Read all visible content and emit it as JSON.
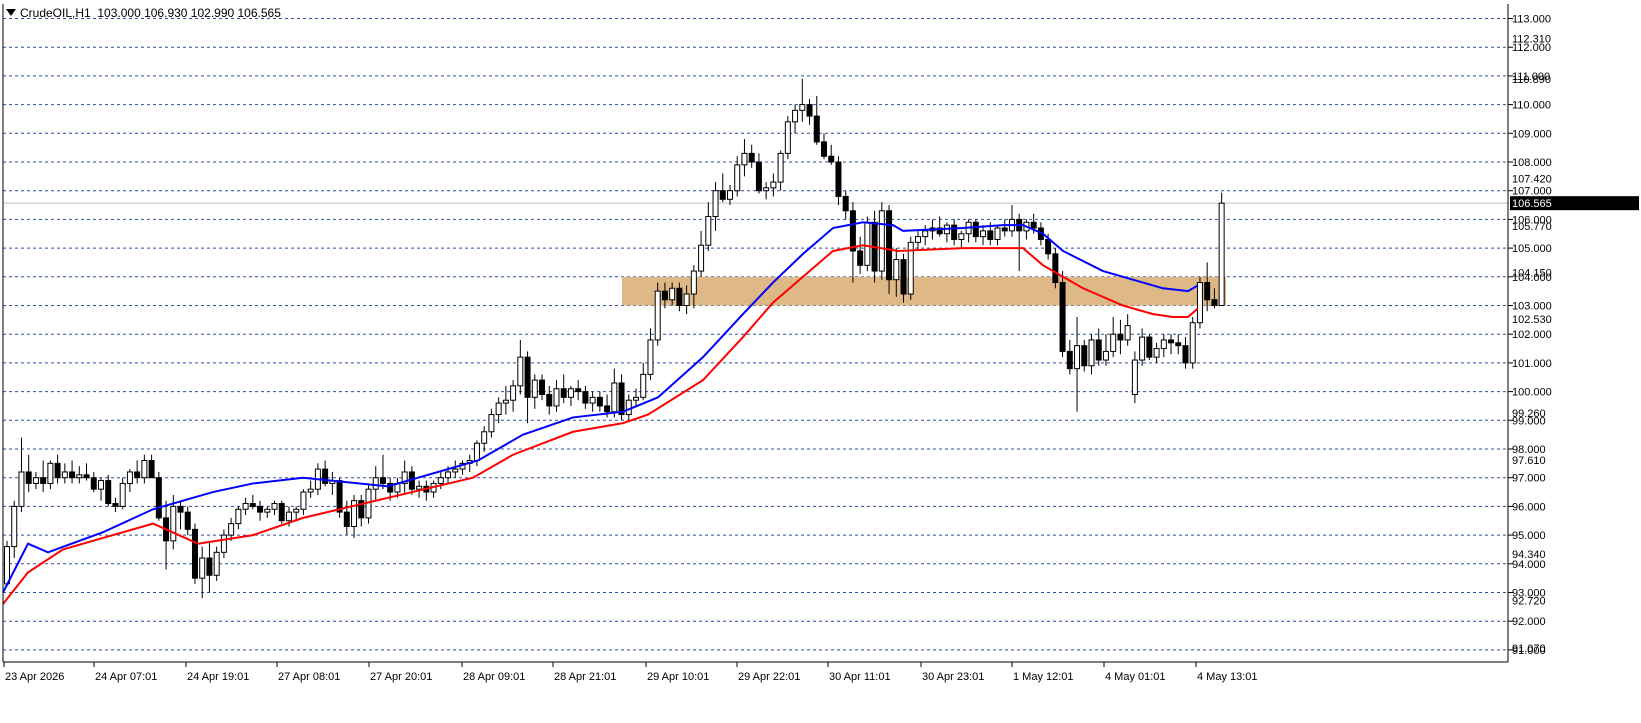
{
  "header": {
    "symbol_timeframe": "CrudeOIL,H1",
    "ohlc": "103.000 106.930 102.990 106.565"
  },
  "colors": {
    "bullish_body": "#ffffff",
    "bearish_body": "#000000",
    "ma_fast": "#0000ff",
    "ma_slow": "#ff0000",
    "zone_fill": "#deb887",
    "grid": "#2f4f9f",
    "price_line": "#c0c0c0"
  },
  "chart_data": {
    "type": "candlestick",
    "symbol": "CrudeOIL",
    "timeframe": "H1",
    "grid": true,
    "last_price": 106.565,
    "ylim": [
      90.5,
      113.5
    ],
    "y_ticks": [
      "113.000",
      "112.000",
      "111.000",
      "110.000",
      "109.000",
      "108.000",
      "107.000",
      "106.000",
      "105.000",
      "104.000",
      "103.000",
      "102.000",
      "101.000",
      "100.000",
      "99.000",
      "98.000",
      "97.000",
      "96.000",
      "95.000",
      "94.000",
      "93.000",
      "92.000",
      "91.000"
    ],
    "y_marker_labels": [
      "112.310",
      "110.890",
      "107.420",
      "105.770",
      "104.150",
      "102.530",
      "99.260",
      "97.610",
      "94.340",
      "92.720",
      "91.070"
    ],
    "x_ticks": [
      "23 Apr 2026",
      "24 Apr 07:01",
      "24 Apr 19:01",
      "27 Apr 08:01",
      "27 Apr 20:01",
      "28 Apr 09:01",
      "28 Apr 21:01",
      "29 Apr 10:01",
      "29 Apr 22:01",
      "30 Apr 11:01",
      "30 Apr 23:01",
      "1 May 12:01",
      "4 May 01:01",
      "4 May 13:01"
    ],
    "zone": {
      "from": 103.0,
      "to": 104.0
    },
    "candles": [
      [
        93.3,
        94.8,
        93.2,
        94.6
      ],
      [
        94.6,
        96.2,
        94.2,
        96.0
      ],
      [
        96.0,
        98.4,
        95.8,
        97.2
      ],
      [
        97.2,
        97.8,
        96.5,
        96.8
      ],
      [
        96.8,
        97.2,
        96.6,
        97.0
      ],
      [
        97.0,
        97.6,
        96.5,
        96.8
      ],
      [
        96.8,
        97.6,
        96.6,
        97.5
      ],
      [
        97.5,
        97.8,
        96.8,
        97.0
      ],
      [
        97.0,
        97.5,
        96.8,
        97.2
      ],
      [
        97.2,
        97.6,
        96.8,
        97.0
      ],
      [
        97.0,
        97.4,
        96.8,
        97.1
      ],
      [
        97.1,
        97.5,
        96.9,
        97.0
      ],
      [
        97.0,
        97.2,
        96.5,
        96.6
      ],
      [
        96.6,
        97.0,
        96.2,
        96.9
      ],
      [
        96.9,
        97.1,
        96.0,
        96.1
      ],
      [
        96.1,
        96.3,
        95.8,
        96.0
      ],
      [
        96.0,
        97.0,
        95.9,
        96.8
      ],
      [
        96.8,
        97.3,
        96.5,
        97.2
      ],
      [
        97.2,
        97.6,
        96.8,
        97.0
      ],
      [
        97.0,
        97.8,
        96.8,
        97.6
      ],
      [
        97.6,
        97.8,
        97.0,
        97.0
      ],
      [
        97.0,
        97.2,
        95.5,
        95.6
      ],
      [
        95.6,
        96.2,
        93.8,
        94.8
      ],
      [
        94.8,
        96.4,
        94.5,
        96.0
      ],
      [
        96.0,
        96.2,
        95.2,
        95.8
      ],
      [
        95.8,
        96.0,
        95.0,
        95.2
      ],
      [
        95.2,
        95.4,
        93.3,
        93.5
      ],
      [
        93.5,
        94.6,
        92.8,
        94.2
      ],
      [
        94.2,
        94.8,
        93.0,
        93.6
      ],
      [
        93.6,
        94.6,
        93.4,
        94.4
      ],
      [
        94.4,
        95.2,
        94.2,
        95.0
      ],
      [
        95.0,
        95.6,
        94.8,
        95.4
      ],
      [
        95.4,
        96.0,
        95.2,
        95.9
      ],
      [
        95.9,
        96.3,
        95.7,
        96.1
      ],
      [
        96.1,
        96.4,
        95.9,
        96.0
      ],
      [
        96.0,
        96.2,
        95.5,
        95.8
      ],
      [
        95.8,
        96.0,
        95.6,
        95.9
      ],
      [
        95.9,
        96.2,
        95.7,
        96.1
      ],
      [
        96.1,
        96.2,
        95.4,
        95.5
      ],
      [
        95.5,
        96.0,
        95.3,
        95.8
      ],
      [
        95.8,
        96.0,
        95.5,
        95.9
      ],
      [
        95.9,
        96.6,
        95.7,
        96.5
      ],
      [
        96.5,
        96.9,
        96.3,
        96.6
      ],
      [
        96.6,
        97.5,
        96.4,
        97.3
      ],
      [
        97.3,
        97.6,
        96.7,
        96.8
      ],
      [
        96.8,
        97.2,
        96.4,
        96.9
      ],
      [
        96.9,
        97.0,
        95.6,
        95.8
      ],
      [
        95.8,
        96.2,
        95.0,
        95.3
      ],
      [
        95.3,
        96.4,
        94.9,
        96.2
      ],
      [
        96.2,
        96.4,
        95.3,
        95.6
      ],
      [
        95.6,
        96.8,
        95.4,
        96.6
      ],
      [
        96.6,
        97.4,
        96.2,
        97.0
      ],
      [
        97.0,
        97.8,
        96.6,
        96.8
      ],
      [
        96.8,
        97.0,
        96.2,
        96.5
      ],
      [
        96.5,
        97.0,
        96.3,
        96.8
      ],
      [
        96.8,
        97.6,
        96.4,
        97.2
      ],
      [
        97.2,
        97.4,
        96.4,
        96.6
      ],
      [
        96.6,
        96.9,
        96.3,
        96.7
      ],
      [
        96.7,
        96.9,
        96.2,
        96.5
      ],
      [
        96.5,
        96.9,
        96.3,
        96.8
      ],
      [
        96.8,
        97.2,
        96.6,
        97.0
      ],
      [
        97.0,
        97.4,
        96.8,
        97.2
      ],
      [
        97.2,
        97.6,
        97.0,
        97.3
      ],
      [
        97.3,
        97.6,
        97.1,
        97.5
      ],
      [
        97.5,
        97.8,
        97.2,
        97.6
      ],
      [
        97.6,
        98.3,
        97.4,
        98.2
      ],
      [
        98.2,
        98.8,
        97.9,
        98.6
      ],
      [
        98.6,
        99.4,
        98.4,
        99.2
      ],
      [
        99.2,
        99.8,
        98.9,
        99.6
      ],
      [
        99.6,
        100.2,
        99.2,
        99.7
      ],
      [
        99.7,
        100.4,
        99.3,
        100.2
      ],
      [
        100.2,
        101.8,
        99.9,
        101.2
      ],
      [
        101.2,
        101.4,
        98.9,
        99.8
      ],
      [
        99.8,
        100.6,
        99.4,
        100.4
      ],
      [
        100.4,
        100.6,
        99.7,
        99.9
      ],
      [
        99.9,
        100.2,
        99.2,
        99.5
      ],
      [
        99.5,
        100.4,
        99.3,
        100.1
      ],
      [
        100.1,
        100.6,
        99.6,
        99.8
      ],
      [
        99.8,
        100.2,
        99.5,
        100.1
      ],
      [
        100.1,
        100.4,
        99.7,
        100.0
      ],
      [
        100.0,
        100.2,
        99.4,
        99.6
      ],
      [
        99.6,
        100.0,
        99.3,
        99.8
      ],
      [
        99.8,
        100.0,
        99.3,
        99.5
      ],
      [
        99.5,
        99.9,
        99.1,
        99.3
      ],
      [
        99.3,
        100.8,
        99.1,
        100.3
      ],
      [
        100.3,
        100.6,
        99.0,
        99.2
      ],
      [
        99.2,
        99.9,
        99.0,
        99.7
      ],
      [
        99.7,
        100.1,
        99.5,
        99.8
      ],
      [
        99.8,
        101.0,
        99.7,
        100.6
      ],
      [
        100.6,
        102.2,
        100.4,
        101.8
      ],
      [
        101.8,
        103.8,
        101.6,
        103.5
      ],
      [
        103.5,
        103.8,
        102.9,
        103.2
      ],
      [
        103.2,
        103.8,
        103.0,
        103.6
      ],
      [
        103.6,
        103.8,
        102.8,
        103.0
      ],
      [
        103.0,
        103.7,
        102.7,
        103.4
      ],
      [
        103.4,
        104.4,
        102.9,
        104.2
      ],
      [
        104.2,
        105.6,
        104.0,
        105.1
      ],
      [
        105.1,
        106.6,
        104.9,
        106.1
      ],
      [
        106.1,
        107.3,
        105.6,
        107.0
      ],
      [
        107.0,
        107.6,
        106.6,
        106.7
      ],
      [
        106.7,
        107.2,
        106.5,
        107.0
      ],
      [
        107.0,
        108.2,
        106.8,
        107.9
      ],
      [
        107.9,
        108.8,
        107.5,
        108.3
      ],
      [
        108.3,
        108.6,
        107.8,
        108.0
      ],
      [
        108.0,
        108.3,
        106.9,
        107.0
      ],
      [
        107.0,
        107.3,
        106.7,
        107.1
      ],
      [
        107.1,
        107.6,
        106.8,
        107.3
      ],
      [
        107.3,
        108.4,
        107.0,
        108.3
      ],
      [
        108.3,
        109.6,
        108.1,
        109.4
      ],
      [
        109.4,
        110.0,
        109.0,
        109.8
      ],
      [
        109.8,
        110.9,
        109.4,
        110.0
      ],
      [
        110.0,
        110.2,
        109.3,
        109.6
      ],
      [
        109.6,
        110.3,
        108.6,
        108.7
      ],
      [
        108.7,
        109.0,
        108.1,
        108.2
      ],
      [
        108.2,
        108.6,
        107.9,
        108.0
      ],
      [
        108.0,
        108.2,
        106.5,
        106.8
      ],
      [
        106.8,
        107.0,
        106.0,
        106.3
      ],
      [
        106.3,
        106.6,
        103.8,
        104.9
      ],
      [
        104.9,
        105.4,
        104.1,
        104.4
      ],
      [
        104.4,
        106.1,
        104.2,
        105.9
      ],
      [
        105.9,
        106.3,
        103.8,
        104.2
      ],
      [
        104.2,
        106.6,
        103.9,
        106.3
      ],
      [
        106.3,
        106.5,
        103.4,
        103.9
      ],
      [
        103.9,
        105.0,
        103.3,
        104.6
      ],
      [
        104.6,
        104.8,
        103.1,
        103.4
      ],
      [
        103.4,
        105.4,
        103.2,
        105.2
      ],
      [
        105.2,
        105.6,
        104.9,
        105.4
      ],
      [
        105.4,
        105.8,
        105.1,
        105.6
      ],
      [
        105.6,
        106.0,
        105.3,
        105.7
      ],
      [
        105.7,
        106.1,
        105.4,
        105.5
      ],
      [
        105.5,
        105.9,
        105.2,
        105.8
      ],
      [
        105.8,
        106.0,
        105.1,
        105.3
      ],
      [
        105.3,
        105.6,
        105.0,
        105.5
      ],
      [
        105.5,
        106.0,
        105.2,
        105.9
      ],
      [
        105.9,
        106.0,
        105.2,
        105.4
      ],
      [
        105.4,
        105.8,
        105.1,
        105.6
      ],
      [
        105.6,
        105.9,
        105.1,
        105.3
      ],
      [
        105.3,
        105.8,
        105.1,
        105.7
      ],
      [
        105.7,
        106.0,
        105.4,
        105.6
      ],
      [
        105.6,
        106.5,
        105.4,
        106.0
      ],
      [
        106.0,
        106.2,
        104.2,
        105.6
      ],
      [
        105.6,
        106.0,
        105.3,
        105.9
      ],
      [
        105.9,
        106.2,
        105.5,
        105.7
      ],
      [
        105.7,
        105.9,
        105.1,
        105.3
      ],
      [
        105.3,
        105.5,
        104.6,
        104.8
      ],
      [
        104.8,
        105.0,
        103.6,
        103.8
      ],
      [
        103.8,
        104.2,
        101.2,
        101.4
      ],
      [
        101.4,
        101.8,
        100.6,
        100.8
      ],
      [
        100.8,
        102.6,
        99.3,
        101.6
      ],
      [
        101.6,
        101.8,
        100.7,
        100.9
      ],
      [
        100.9,
        102.0,
        100.6,
        101.8
      ],
      [
        101.8,
        102.2,
        100.9,
        101.1
      ],
      [
        101.1,
        102.0,
        100.9,
        101.4
      ],
      [
        101.4,
        102.6,
        101.2,
        102.0
      ],
      [
        102.0,
        102.5,
        101.3,
        101.8
      ],
      [
        101.8,
        102.7,
        101.6,
        102.3
      ],
      [
        99.9,
        101.4,
        99.6,
        101.1
      ],
      [
        101.1,
        102.2,
        100.9,
        101.9
      ],
      [
        101.9,
        102.0,
        101.1,
        101.2
      ],
      [
        101.2,
        101.7,
        101.0,
        101.5
      ],
      [
        101.5,
        102.0,
        101.2,
        101.8
      ],
      [
        101.8,
        102.0,
        101.3,
        101.7
      ],
      [
        101.7,
        102.0,
        101.3,
        101.6
      ],
      [
        101.6,
        101.9,
        100.8,
        101.0
      ],
      [
        101.0,
        102.6,
        100.8,
        102.4
      ],
      [
        102.4,
        104.0,
        102.2,
        103.8
      ],
      [
        103.8,
        104.5,
        102.8,
        103.2
      ],
      [
        103.2,
        103.6,
        102.9,
        103.0
      ],
      [
        103.0,
        106.93,
        102.99,
        106.565
      ]
    ],
    "ma_fast": [
      [
        0,
        93.0
      ],
      [
        25,
        94.7
      ],
      [
        45,
        94.4
      ],
      [
        100,
        95.1
      ],
      [
        150,
        95.9
      ],
      [
        210,
        96.5
      ],
      [
        250,
        96.8
      ],
      [
        300,
        97.0
      ],
      [
        385,
        96.7
      ],
      [
        475,
        97.6
      ],
      [
        520,
        98.5
      ],
      [
        570,
        99.1
      ],
      [
        620,
        99.3
      ],
      [
        655,
        99.8
      ],
      [
        700,
        101.2
      ],
      [
        740,
        102.7
      ],
      [
        770,
        103.8
      ],
      [
        800,
        104.8
      ],
      [
        830,
        105.7
      ],
      [
        860,
        105.9
      ],
      [
        890,
        105.8
      ],
      [
        900,
        105.6
      ],
      [
        960,
        105.7
      ],
      [
        1000,
        105.8
      ],
      [
        1020,
        105.8
      ],
      [
        1040,
        105.5
      ],
      [
        1060,
        104.9
      ],
      [
        1100,
        104.2
      ],
      [
        1140,
        103.8
      ],
      [
        1160,
        103.6
      ],
      [
        1185,
        103.5
      ],
      [
        1195,
        103.7
      ]
    ],
    "ma_slow": [
      [
        0,
        92.6
      ],
      [
        25,
        93.7
      ],
      [
        60,
        94.5
      ],
      [
        100,
        94.9
      ],
      [
        150,
        95.4
      ],
      [
        195,
        94.7
      ],
      [
        250,
        95.0
      ],
      [
        300,
        95.6
      ],
      [
        385,
        96.3
      ],
      [
        470,
        97.0
      ],
      [
        510,
        97.8
      ],
      [
        570,
        98.6
      ],
      [
        620,
        98.9
      ],
      [
        645,
        99.2
      ],
      [
        700,
        100.4
      ],
      [
        740,
        101.9
      ],
      [
        770,
        103.1
      ],
      [
        800,
        104.0
      ],
      [
        830,
        104.9
      ],
      [
        860,
        105.1
      ],
      [
        895,
        104.9
      ],
      [
        960,
        105.0
      ],
      [
        1000,
        105.0
      ],
      [
        1020,
        105.0
      ],
      [
        1040,
        104.4
      ],
      [
        1080,
        103.6
      ],
      [
        1120,
        103.0
      ],
      [
        1150,
        102.7
      ],
      [
        1170,
        102.6
      ],
      [
        1185,
        102.6
      ],
      [
        1195,
        102.9
      ]
    ]
  }
}
